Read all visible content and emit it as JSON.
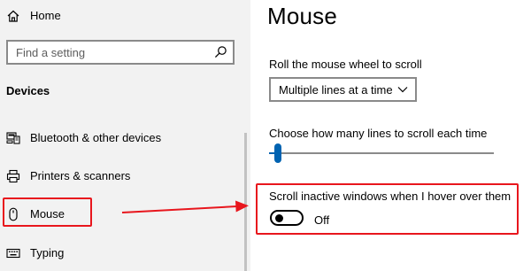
{
  "sidebar": {
    "home_label": "Home",
    "search_placeholder": "Find a setting",
    "section_title": "Devices",
    "items": [
      {
        "label": "Bluetooth & other devices",
        "icon": "bluetooth-devices-icon"
      },
      {
        "label": "Printers & scanners",
        "icon": "printer-icon"
      },
      {
        "label": "Mouse",
        "icon": "mouse-icon"
      },
      {
        "label": "Typing",
        "icon": "keyboard-icon"
      }
    ]
  },
  "main": {
    "title": "Mouse",
    "scroll_setting": {
      "label": "Roll the mouse wheel to scroll",
      "selected": "Multiple lines at a time"
    },
    "lines_setting": {
      "label": "Choose how many lines to scroll each time",
      "value_fraction": 0.01
    },
    "inactive_scroll": {
      "label": "Scroll inactive windows when I hover over them",
      "state": "Off"
    }
  },
  "colors": {
    "annotation_red": "#e8161d",
    "accent_blue": "#0063b1",
    "sidebar_bg": "#f2f2f2"
  }
}
